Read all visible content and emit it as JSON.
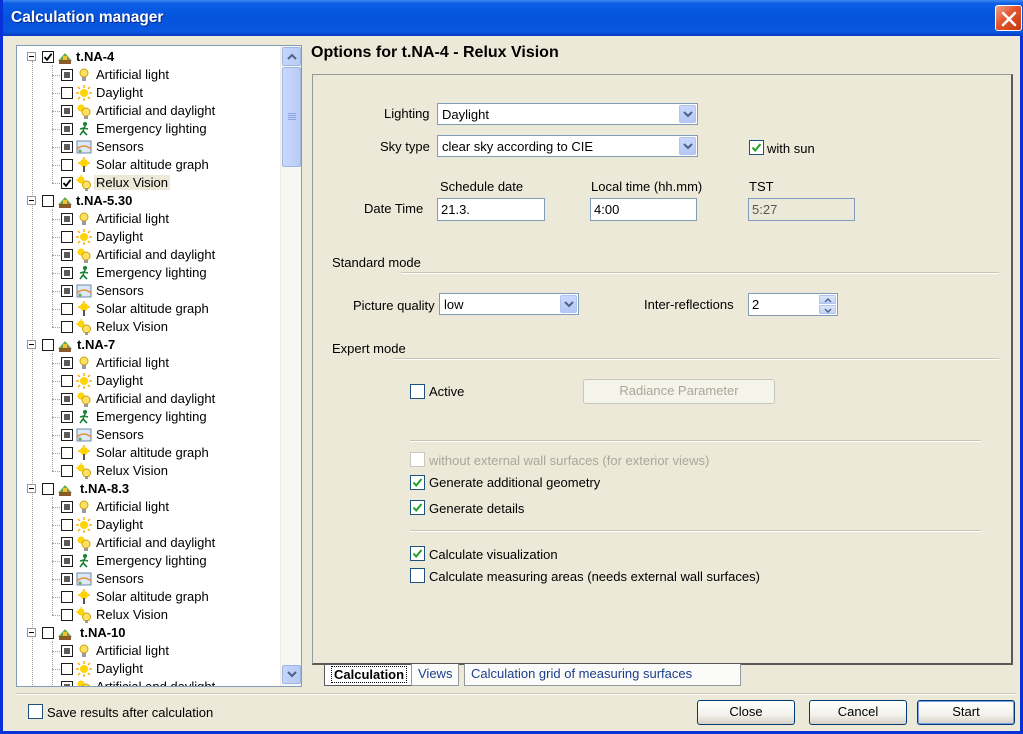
{
  "window": {
    "title": "Calculation manager"
  },
  "tree": {
    "projects": [
      {
        "name": "t.NA-4",
        "checked": true,
        "items": [
          {
            "label": "Artificial light",
            "state": "partial",
            "icon": "lamp-icon"
          },
          {
            "label": "Daylight",
            "state": "unchecked",
            "icon": "sun-icon"
          },
          {
            "label": "Artificial and daylight",
            "state": "partial",
            "icon": "lamp-sun-icon"
          },
          {
            "label": "Emergency lighting",
            "state": "partial",
            "icon": "emergency-exit-icon"
          },
          {
            "label": "Sensors",
            "state": "partial",
            "icon": "sensor-icon"
          },
          {
            "label": "Solar altitude graph",
            "state": "unchecked",
            "icon": "solar-graph-icon"
          },
          {
            "label": "Relux Vision",
            "state": "checked",
            "icon": "relux-vision-icon",
            "selected": true
          }
        ]
      },
      {
        "name": "t.NA-5.30",
        "checked": false,
        "items": [
          {
            "label": "Artificial light",
            "state": "partial",
            "icon": "lamp-icon"
          },
          {
            "label": "Daylight",
            "state": "unchecked",
            "icon": "sun-icon"
          },
          {
            "label": "Artificial and daylight",
            "state": "partial",
            "icon": "lamp-sun-icon"
          },
          {
            "label": "Emergency lighting",
            "state": "partial",
            "icon": "emergency-exit-icon"
          },
          {
            "label": "Sensors",
            "state": "partial",
            "icon": "sensor-icon"
          },
          {
            "label": "Solar altitude graph",
            "state": "unchecked",
            "icon": "solar-graph-icon"
          },
          {
            "label": "Relux Vision",
            "state": "unchecked",
            "icon": "relux-vision-icon"
          }
        ]
      },
      {
        "name": "t.NA-7",
        "checked": false,
        "items": [
          {
            "label": "Artificial light",
            "state": "partial",
            "icon": "lamp-icon"
          },
          {
            "label": "Daylight",
            "state": "unchecked",
            "icon": "sun-icon"
          },
          {
            "label": "Artificial and daylight",
            "state": "partial",
            "icon": "lamp-sun-icon"
          },
          {
            "label": "Emergency lighting",
            "state": "partial",
            "icon": "emergency-exit-icon"
          },
          {
            "label": "Sensors",
            "state": "partial",
            "icon": "sensor-icon"
          },
          {
            "label": "Solar altitude graph",
            "state": "unchecked",
            "icon": "solar-graph-icon"
          },
          {
            "label": "Relux Vision",
            "state": "unchecked",
            "icon": "relux-vision-icon"
          }
        ]
      },
      {
        "name": "t.NA-8.3",
        "checked": false,
        "items": [
          {
            "label": "Artificial light",
            "state": "partial",
            "icon": "lamp-icon"
          },
          {
            "label": "Daylight",
            "state": "unchecked",
            "icon": "sun-icon"
          },
          {
            "label": "Artificial and daylight",
            "state": "partial",
            "icon": "lamp-sun-icon"
          },
          {
            "label": "Emergency lighting",
            "state": "partial",
            "icon": "emergency-exit-icon"
          },
          {
            "label": "Sensors",
            "state": "partial",
            "icon": "sensor-icon"
          },
          {
            "label": "Solar altitude graph",
            "state": "unchecked",
            "icon": "solar-graph-icon"
          },
          {
            "label": "Relux Vision",
            "state": "unchecked",
            "icon": "relux-vision-icon"
          }
        ]
      },
      {
        "name": "t.NA-10",
        "checked": false,
        "items": [
          {
            "label": "Artificial light",
            "state": "partial",
            "icon": "lamp-icon"
          },
          {
            "label": "Daylight",
            "state": "unchecked",
            "icon": "sun-icon"
          },
          {
            "label": "Artificial and daylight",
            "state": "partial",
            "icon": "lamp-sun-icon"
          }
        ]
      }
    ]
  },
  "options": {
    "title": "Options for t.NA-4 - Relux Vision",
    "lighting_label": "Lighting",
    "lighting_value": "Daylight",
    "sky_label": "Sky type",
    "sky_value": "clear sky according to CIE",
    "with_sun_label": "with sun",
    "with_sun_checked": true,
    "datetime_label": "Date  Time",
    "schedule_date_label": "Schedule date",
    "schedule_date_value": "21.3.",
    "local_time_label": "Local time (hh.mm)",
    "local_time_value": "4:00",
    "tst_label": "TST",
    "tst_value": "5:27",
    "standard_mode_label": "Standard mode",
    "picture_quality_label": "Picture quality",
    "picture_quality_value": "low",
    "inter_reflections_label": "Inter-reflections",
    "inter_reflections_value": "2",
    "expert_mode_label": "Expert mode",
    "active_label": "Active",
    "radiance_button": "Radiance Parameter",
    "without_external_label": "without external wall surfaces (for exterior views)",
    "gen_geometry_label": "Generate additional geometry",
    "gen_details_label": "Generate details",
    "calc_visualization_label": "Calculate visualization",
    "calc_measuring_label": "Calculate measuring areas (needs external wall surfaces)"
  },
  "tabs": [
    {
      "label": "Calculation",
      "active": true
    },
    {
      "label": "Views",
      "active": false
    },
    {
      "label": "Calculation grid of measuring surfaces",
      "active": false
    }
  ],
  "footer": {
    "save_results_label": "Save results after calculation",
    "close_button": "Close",
    "cancel_button": "Cancel",
    "start_button": "Start"
  }
}
